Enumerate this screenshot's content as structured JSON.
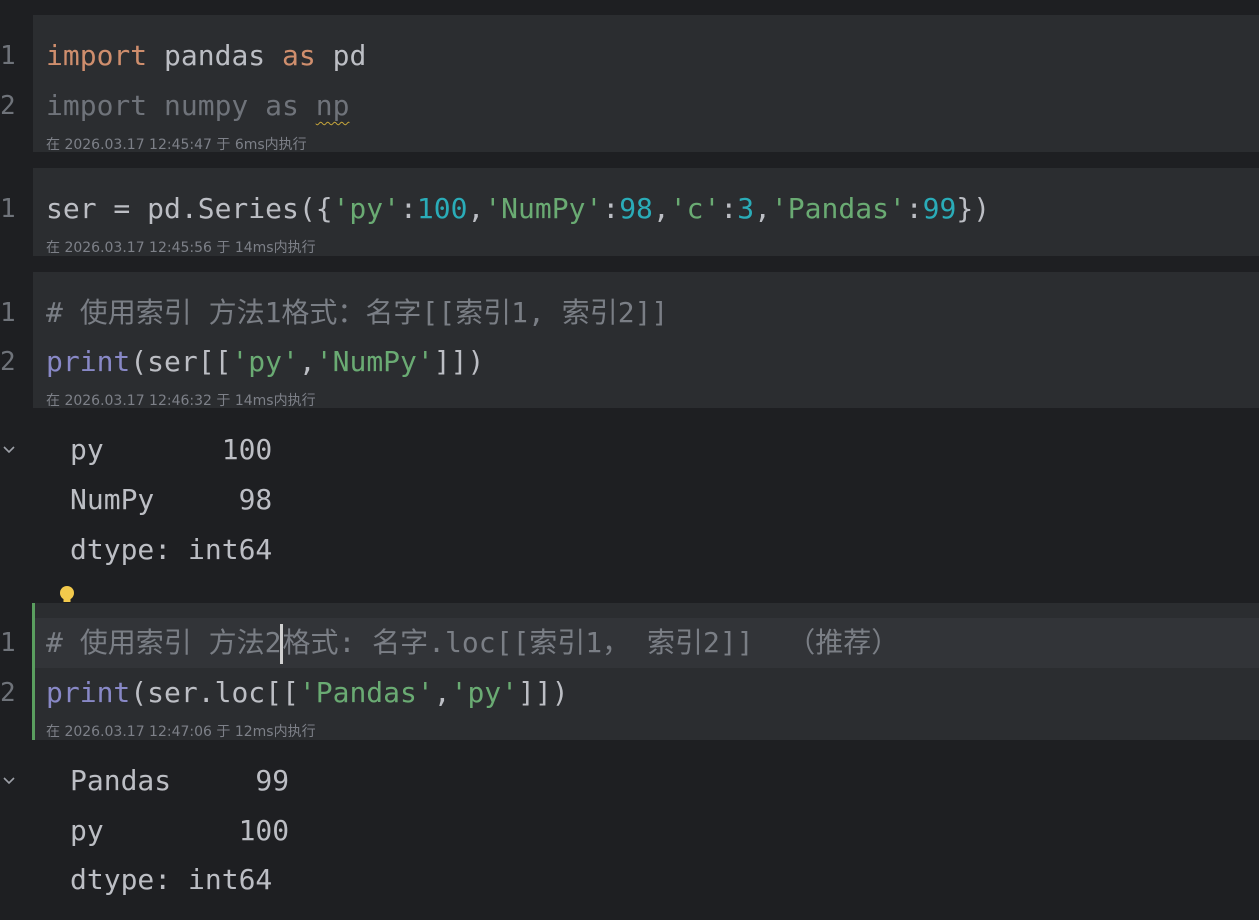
{
  "cells": [
    {
      "gutter": [
        "1",
        "2"
      ],
      "lines": [
        [
          {
            "t": "import",
            "c": "kw"
          },
          {
            "t": " pandas "
          },
          {
            "t": "as",
            "c": "kw"
          },
          {
            "t": " pd"
          }
        ],
        [
          {
            "t": "import numpy as ",
            "c": "dim"
          },
          {
            "t": "np",
            "c": "dim squiggle"
          }
        ]
      ],
      "meta": "在 2026.03.17 12:45:47 于 6ms内执行"
    },
    {
      "gutter": [
        "1"
      ],
      "lines": [
        [
          {
            "t": "ser = pd.Series({"
          },
          {
            "t": "'py'",
            "c": "str"
          },
          {
            "t": ":"
          },
          {
            "t": "100",
            "c": "num"
          },
          {
            "t": ","
          },
          {
            "t": "'NumPy'",
            "c": "str"
          },
          {
            "t": ":"
          },
          {
            "t": "98",
            "c": "num"
          },
          {
            "t": ","
          },
          {
            "t": "'c'",
            "c": "str"
          },
          {
            "t": ":"
          },
          {
            "t": "3",
            "c": "num"
          },
          {
            "t": ","
          },
          {
            "t": "'Pandas'",
            "c": "str"
          },
          {
            "t": ":"
          },
          {
            "t": "99",
            "c": "num"
          },
          {
            "t": "})"
          }
        ]
      ],
      "meta": "在 2026.03.17 12:45:56 于 14ms内执行"
    },
    {
      "gutter": [
        "1",
        "2"
      ],
      "lines": [
        [
          {
            "t": "# 使用索引 方法1格式：名字[[索引1, 索引2]]",
            "c": "cmt"
          }
        ],
        [
          {
            "t": "print",
            "c": "fn"
          },
          {
            "t": "(ser[["
          },
          {
            "t": "'py'",
            "c": "str"
          },
          {
            "t": ","
          },
          {
            "t": "'NumPy'",
            "c": "str"
          },
          {
            "t": "]])"
          }
        ]
      ],
      "meta": "在 2026.03.17 12:46:32 于 14ms内执行",
      "output": [
        "py       100",
        "NumPy     98",
        "dtype: int64"
      ]
    },
    {
      "gutter": [
        "1",
        "2"
      ],
      "lines": [
        [
          {
            "t": "# 使用索引 方法2",
            "c": "cmt"
          },
          {
            "t": "|caret|"
          },
          {
            "t": "格式: 名字.loc[[索引1， 索引2]]  （推荐）",
            "c": "cmt"
          }
        ],
        [
          {
            "t": "print",
            "c": "fn"
          },
          {
            "t": "(ser.loc[["
          },
          {
            "t": "'Pandas'",
            "c": "str"
          },
          {
            "t": ","
          },
          {
            "t": "'py'",
            "c": "str"
          },
          {
            "t": "]])"
          }
        ]
      ],
      "meta": "在 2026.03.17 12:47:06 于 12ms内执行",
      "output": [
        "Pandas     99",
        "py        100",
        "dtype: int64"
      ]
    }
  ],
  "icons": {
    "collapse": "chevron-down-icon",
    "hint": "lightbulb-icon"
  },
  "colors": {
    "keyword": "#cf8e6d",
    "string": "#6aab73",
    "number": "#2aacb8",
    "builtin": "#8888c6",
    "comment": "#7a7e85",
    "active_border": "#5a9e5f"
  }
}
